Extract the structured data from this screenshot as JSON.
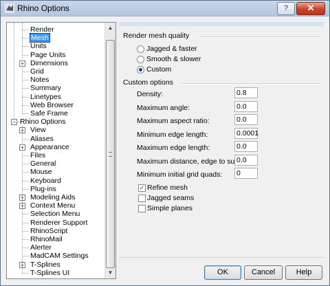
{
  "window": {
    "title": "Rhino Options",
    "close_glyph": "✕",
    "help_glyph": "?"
  },
  "tree": {
    "items": [
      {
        "label": "Render",
        "indent": 1,
        "expander": ""
      },
      {
        "label": "Mesh",
        "indent": 1,
        "expander": "",
        "selected": true
      },
      {
        "label": "Units",
        "indent": 1,
        "expander": ""
      },
      {
        "label": "Page Units",
        "indent": 1,
        "expander": ""
      },
      {
        "label": "Dimensions",
        "indent": 1,
        "expander": "+"
      },
      {
        "label": "Grid",
        "indent": 1,
        "expander": ""
      },
      {
        "label": "Notes",
        "indent": 1,
        "expander": ""
      },
      {
        "label": "Summary",
        "indent": 1,
        "expander": ""
      },
      {
        "label": "Linetypes",
        "indent": 1,
        "expander": ""
      },
      {
        "label": "Web Browser",
        "indent": 1,
        "expander": ""
      },
      {
        "label": "Safe Frame",
        "indent": 1,
        "expander": ""
      },
      {
        "label": "Rhino Options",
        "indent": 0,
        "expander": "−"
      },
      {
        "label": "View",
        "indent": 1,
        "expander": "+"
      },
      {
        "label": "Aliases",
        "indent": 1,
        "expander": ""
      },
      {
        "label": "Appearance",
        "indent": 1,
        "expander": "+"
      },
      {
        "label": "Files",
        "indent": 1,
        "expander": ""
      },
      {
        "label": "General",
        "indent": 1,
        "expander": ""
      },
      {
        "label": "Mouse",
        "indent": 1,
        "expander": ""
      },
      {
        "label": "Keyboard",
        "indent": 1,
        "expander": ""
      },
      {
        "label": "Plug-ins",
        "indent": 1,
        "expander": ""
      },
      {
        "label": "Modeling Aids",
        "indent": 1,
        "expander": "+"
      },
      {
        "label": "Context Menu",
        "indent": 1,
        "expander": "+"
      },
      {
        "label": "Selection Menu",
        "indent": 1,
        "expander": ""
      },
      {
        "label": "Renderer Support",
        "indent": 1,
        "expander": ""
      },
      {
        "label": "RhinoScript",
        "indent": 1,
        "expander": ""
      },
      {
        "label": "RhinoMail",
        "indent": 1,
        "expander": ""
      },
      {
        "label": "Alerter",
        "indent": 1,
        "expander": ""
      },
      {
        "label": "MadCAM Settings",
        "indent": 1,
        "expander": ""
      },
      {
        "label": "T-Splines",
        "indent": 1,
        "expander": "+"
      },
      {
        "label": "T-Splines UI",
        "indent": 1,
        "expander": ""
      }
    ]
  },
  "render_mesh_quality": {
    "title": "Render mesh quality",
    "options": [
      {
        "label": "Jagged & faster",
        "selected": false
      },
      {
        "label": "Smooth & slower",
        "selected": false
      },
      {
        "label": "Custom",
        "selected": true
      }
    ]
  },
  "custom_options": {
    "title": "Custom options",
    "fields": [
      {
        "label": "Density:",
        "value": "0.8"
      },
      {
        "label": "Maximum angle:",
        "value": "0.0"
      },
      {
        "label": "Maximum aspect ratio:",
        "value": "0.0"
      },
      {
        "label": "Minimum edge length:",
        "value": "0.0001"
      },
      {
        "label": "Maximum edge length:",
        "value": "0.0"
      },
      {
        "label": "Maximum distance, edge to surface:",
        "value": "0.0"
      },
      {
        "label": "Minimum initial grid quads:",
        "value": "0"
      }
    ],
    "checkboxes": [
      {
        "label": "Refine mesh",
        "checked": true
      },
      {
        "label": "Jagged seams",
        "checked": false
      },
      {
        "label": "Simple planes",
        "checked": false
      }
    ]
  },
  "buttons": {
    "ok": "OK",
    "cancel": "Cancel",
    "help": "Help"
  }
}
